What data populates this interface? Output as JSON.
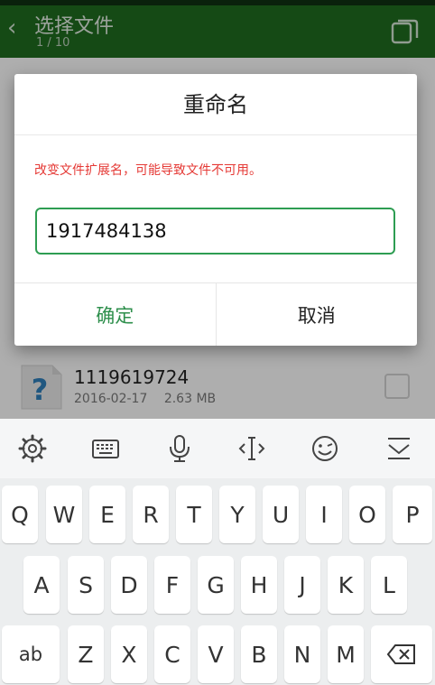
{
  "app_bar": {
    "back_icon": "chevron-left-icon",
    "title": "选择文件",
    "subtitle": "1 / 10",
    "action_icon": "copy-icon"
  },
  "file": {
    "name": "1119619724",
    "date": "2016-02-17",
    "size": "2.63 MB",
    "icon": "unknown-file-icon"
  },
  "dialog": {
    "title": "重命名",
    "warning": "改变文件扩展名，可能导致文件不可用。",
    "input_value": "1917484138",
    "confirm": "确定",
    "cancel": "取消"
  },
  "keyboard": {
    "toolbar_icons": [
      "gear-icon",
      "keyboard-icon",
      "mic-icon",
      "cursor-icon",
      "emoji-icon",
      "collapse-icon"
    ],
    "row1": [
      "Q",
      "W",
      "E",
      "R",
      "T",
      "Y",
      "U",
      "I",
      "O",
      "P"
    ],
    "row2": [
      "A",
      "S",
      "D",
      "F",
      "G",
      "H",
      "J",
      "K",
      "L"
    ],
    "row3": [
      "Z",
      "X",
      "C",
      "V",
      "B",
      "N",
      "M"
    ],
    "shift_label": "ab",
    "backspace_icon": "backspace-icon"
  },
  "colors": {
    "app_bar": "#1f6b1f",
    "accent_green": "#2e8f4c",
    "warning_red": "#e53935"
  }
}
